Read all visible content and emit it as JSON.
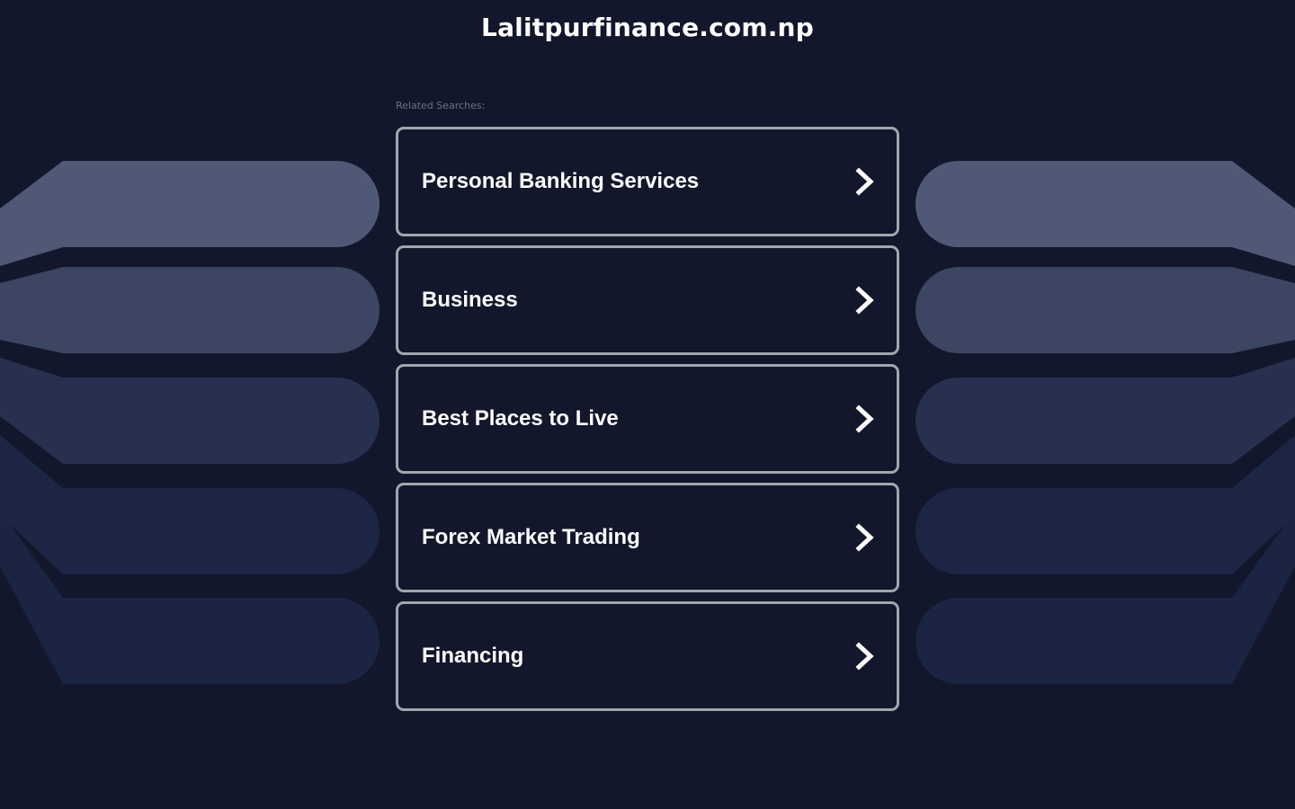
{
  "header": {
    "site_title": "Lalitpurfinance.com.np"
  },
  "related": {
    "label": "Related Searches:",
    "items": [
      {
        "label": "Personal Banking Services",
        "icon": "chevron-right-icon"
      },
      {
        "label": "Business",
        "icon": "chevron-right-icon"
      },
      {
        "label": "Best Places to Live",
        "icon": "chevron-right-icon"
      },
      {
        "label": "Forex Market Trading",
        "icon": "chevron-right-icon"
      },
      {
        "label": "Financing",
        "icon": "chevron-right-icon"
      }
    ]
  },
  "colors": {
    "background": "#12172c",
    "card_border": "#a3a6ad",
    "text": "#ffffff",
    "label_muted": "#6b7287",
    "shape_1": "#4f5875",
    "shape_2": "#3c4562",
    "shape_3": "#283050",
    "shape_4": "#1d2545",
    "shape_5": "#1b2443"
  }
}
